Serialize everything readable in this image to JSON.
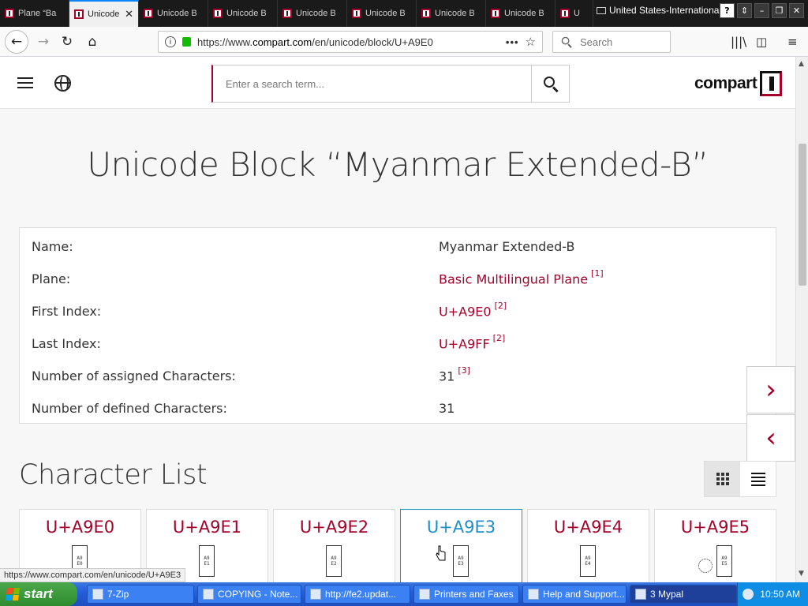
{
  "browser": {
    "tabs": [
      {
        "title": "Plane “Ba",
        "active": false
      },
      {
        "title": "Unicode",
        "active": true
      },
      {
        "title": "Unicode B",
        "active": false
      },
      {
        "title": "Unicode B",
        "active": false
      },
      {
        "title": "Unicode B",
        "active": false
      },
      {
        "title": "Unicode B",
        "active": false
      },
      {
        "title": "Unicode B",
        "active": false
      },
      {
        "title": "Unicode B",
        "active": false
      },
      {
        "title": "U",
        "active": false
      }
    ],
    "language": "United States-International",
    "url_prefix": "https://www.",
    "url_domain": "compart.com",
    "url_path": "/en/unicode/block/U+A9E0",
    "search_placeholder": "Search",
    "status_url": "https://www.compart.com/en/unicode/U+A9E3"
  },
  "site": {
    "search_placeholder": "Enter a search term...",
    "logo_text": "compart",
    "page_title": "Unicode Block “Myanmar Extended-B”",
    "info": [
      {
        "label": "Name:",
        "value": "Myanmar Extended-B",
        "link": false,
        "ref": ""
      },
      {
        "label": "Plane:",
        "value": "Basic Multilingual Plane",
        "link": true,
        "ref": "[1]"
      },
      {
        "label": "First Index:",
        "value": "U+A9E0",
        "link": true,
        "ref": "[2]"
      },
      {
        "label": "Last Index:",
        "value": "U+A9FF",
        "link": true,
        "ref": "[2]"
      },
      {
        "label": "Number of assigned Characters:",
        "value": "31",
        "link": false,
        "ref": "[3]"
      },
      {
        "label": "Number of defined Characters:",
        "value": "31",
        "link": false,
        "ref": ""
      }
    ],
    "nav_next": "›",
    "nav_prev": "‹",
    "section_title": "Character List",
    "characters": [
      {
        "code": "U+A9E0",
        "glyph": "A9\nE0",
        "hover": false,
        "combining": false
      },
      {
        "code": "U+A9E1",
        "glyph": "A9\nE1",
        "hover": false,
        "combining": false
      },
      {
        "code": "U+A9E2",
        "glyph": "A9\nE2",
        "hover": false,
        "combining": false
      },
      {
        "code": "U+A9E3",
        "glyph": "A9\nE3",
        "hover": true,
        "combining": false
      },
      {
        "code": "U+A9E4",
        "glyph": "A9\nE4",
        "hover": false,
        "combining": false
      },
      {
        "code": "U+A9E5",
        "glyph": "A9\nE5",
        "hover": false,
        "combining": true
      }
    ]
  },
  "taskbar": {
    "start_label": "start",
    "tasks": [
      {
        "label": "7-Zip",
        "active": false
      },
      {
        "label": "COPYING - Note...",
        "active": false
      },
      {
        "label": "http://fe2.updat...",
        "active": false
      },
      {
        "label": "Printers and Faxes",
        "active": false
      },
      {
        "label": "Help and Support...",
        "active": false
      },
      {
        "label": "3 Mypal",
        "active": true
      }
    ],
    "clock": "10:50 AM"
  },
  "colors": {
    "accent": "#a5002a",
    "hover_accent": "#1e90c8",
    "taskbar_blue": "#245edb"
  }
}
